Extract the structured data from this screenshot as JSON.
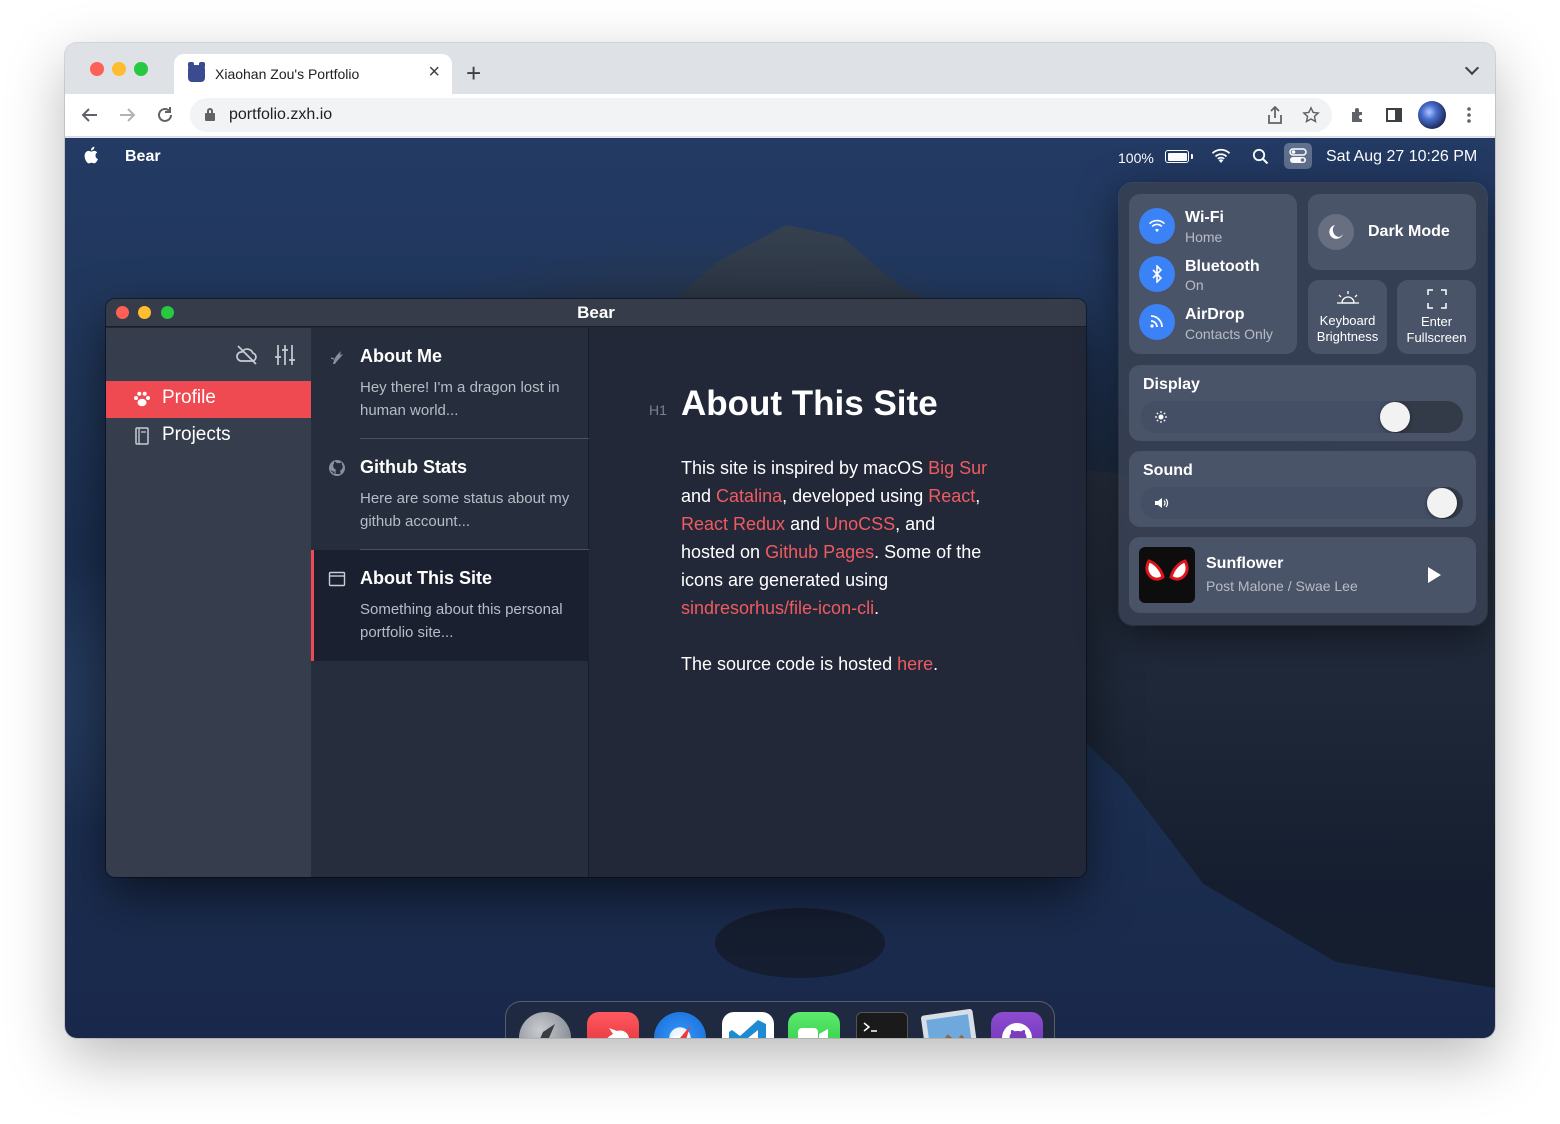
{
  "browser": {
    "tab_title": "Xiaohan Zou's Portfolio",
    "tab_close": "×",
    "new_tab": "+",
    "url": "portfolio.zxh.io"
  },
  "menubar": {
    "app_name": "Bear",
    "battery_percent": "100%",
    "datetime": "Sat Aug 27 10:26 PM"
  },
  "bear": {
    "window_title": "Bear",
    "sidebar": [
      {
        "label": "Profile",
        "icon": "paw-icon",
        "active": true
      },
      {
        "label": "Projects",
        "icon": "book-icon",
        "active": false
      }
    ],
    "notes": [
      {
        "title": "About Me",
        "excerpt": "Hey there! I'm a dragon lost in human world...",
        "icon": "dragon-icon"
      },
      {
        "title": "Github Stats",
        "excerpt": "Here are some status about my github account...",
        "icon": "github-icon"
      },
      {
        "title": "About This Site",
        "excerpt": "Something about this personal portfolio site...",
        "icon": "window-icon",
        "active": true
      }
    ],
    "editor": {
      "heading_tag": "H1",
      "title": "About This Site",
      "p1": {
        "t1": "This site is inspired by macOS ",
        "l1": "Big Sur",
        "t2": " and ",
        "l2": "Catalina",
        "t3": ", developed using ",
        "l3": "React",
        "t4": ", ",
        "l4": "React Redux",
        "t5": " and ",
        "l5": "UnoCSS",
        "t6": ", and hosted on ",
        "l6": "Github Pages",
        "t7": ". Some of the icons are generated using ",
        "l7": "sindresorhus/file-icon-cli",
        "t8": "."
      },
      "p2": {
        "t1": "The source code is hosted ",
        "l1": "here",
        "t2": "."
      }
    }
  },
  "control_center": {
    "wifi": {
      "title": "Wi-Fi",
      "sub": "Home"
    },
    "bluetooth": {
      "title": "Bluetooth",
      "sub": "On"
    },
    "airdrop": {
      "title": "AirDrop",
      "sub": "Contacts Only"
    },
    "dark_mode": "Dark Mode",
    "keyboard": {
      "line1": "Keyboard",
      "line2": "Brightness"
    },
    "fullscreen": {
      "line1": "Enter",
      "line2": "Fullscreen"
    },
    "display": {
      "label": "Display",
      "level": 0.82
    },
    "sound": {
      "label": "Sound",
      "level": 0.98
    },
    "now_playing": {
      "title": "Sunflower",
      "artist": "Post Malone / Swae Lee"
    }
  },
  "dock": [
    "launchpad-icon",
    "bear-icon",
    "safari-icon",
    "vscode-icon",
    "facetime-icon",
    "terminal-icon",
    "preview-icon",
    "github-icon"
  ],
  "colors": {
    "accent": "#ef4a52",
    "link": "#ef5b61",
    "toggle_blue": "#3b82f6"
  }
}
